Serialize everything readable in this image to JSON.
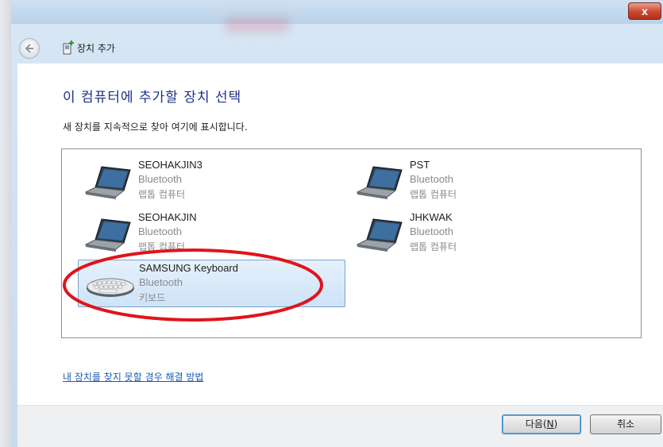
{
  "window": {
    "close_glyph": "x"
  },
  "nav": {
    "title": "장치 추가"
  },
  "main": {
    "heading": "이 컴퓨터에 추가할 장치 선택",
    "subtext": "새 장치를 지속적으로 찾아 여기에 표시합니다."
  },
  "devices": [
    {
      "name": "SEOHAKJIN3",
      "connection": "Bluetooth",
      "type": "랩톱 컴퓨터",
      "icon": "laptop-icon",
      "selected": false
    },
    {
      "name": "PST",
      "connection": "Bluetooth",
      "type": "랩톱 컴퓨터",
      "icon": "laptop-icon",
      "selected": false
    },
    {
      "name": "SEOHAKJIN",
      "connection": "Bluetooth",
      "type": "랩톱 컴퓨터",
      "icon": "laptop-icon",
      "selected": false
    },
    {
      "name": "JHKWAK",
      "connection": "Bluetooth",
      "type": "랩톱 컴퓨터",
      "icon": "laptop-icon",
      "selected": false
    },
    {
      "name": "SAMSUNG Keyboard",
      "connection": "Bluetooth",
      "type": "키보드",
      "icon": "keyboard-icon",
      "selected": true
    }
  ],
  "help": {
    "link_text": "내 장치를 찾지 못할 경우 해결 방법"
  },
  "footer": {
    "next_label": "다음(",
    "next_mnemonic": "N",
    "next_suffix": ")",
    "cancel_label": "취소"
  },
  "colors": {
    "heading": "#1e3287",
    "link": "#1e5bb3",
    "annotation_circle": "#e0141b",
    "selection": "#cde3f7"
  }
}
